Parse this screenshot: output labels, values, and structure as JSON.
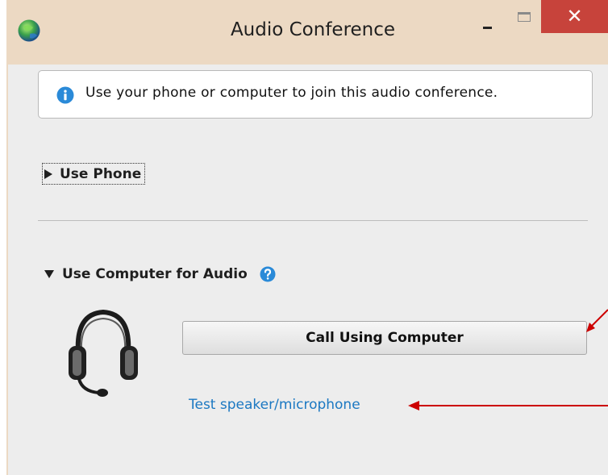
{
  "window": {
    "title": "Audio Conference",
    "close_glyph": "✕"
  },
  "info": {
    "icon": "info-icon",
    "text": "Use your phone or computer to join this audio conference."
  },
  "phone_section": {
    "icon": "triangle-right-icon",
    "label": "Use Phone",
    "expanded": false
  },
  "computer_section": {
    "icon": "triangle-down-icon",
    "label": "Use Computer for Audio",
    "expanded": true,
    "help_icon": "help-icon",
    "device_icon": "headset-icon",
    "call_button_label": "Call Using Computer",
    "test_link_label": "Test speaker/microphone"
  },
  "colors": {
    "title_bar": "#ecd9c3",
    "close_button": "#c7433b",
    "content_bg": "#ededed",
    "link": "#1b78c2",
    "info_blue": "#2a8ad8",
    "annotation_arrow": "#cc0000"
  }
}
